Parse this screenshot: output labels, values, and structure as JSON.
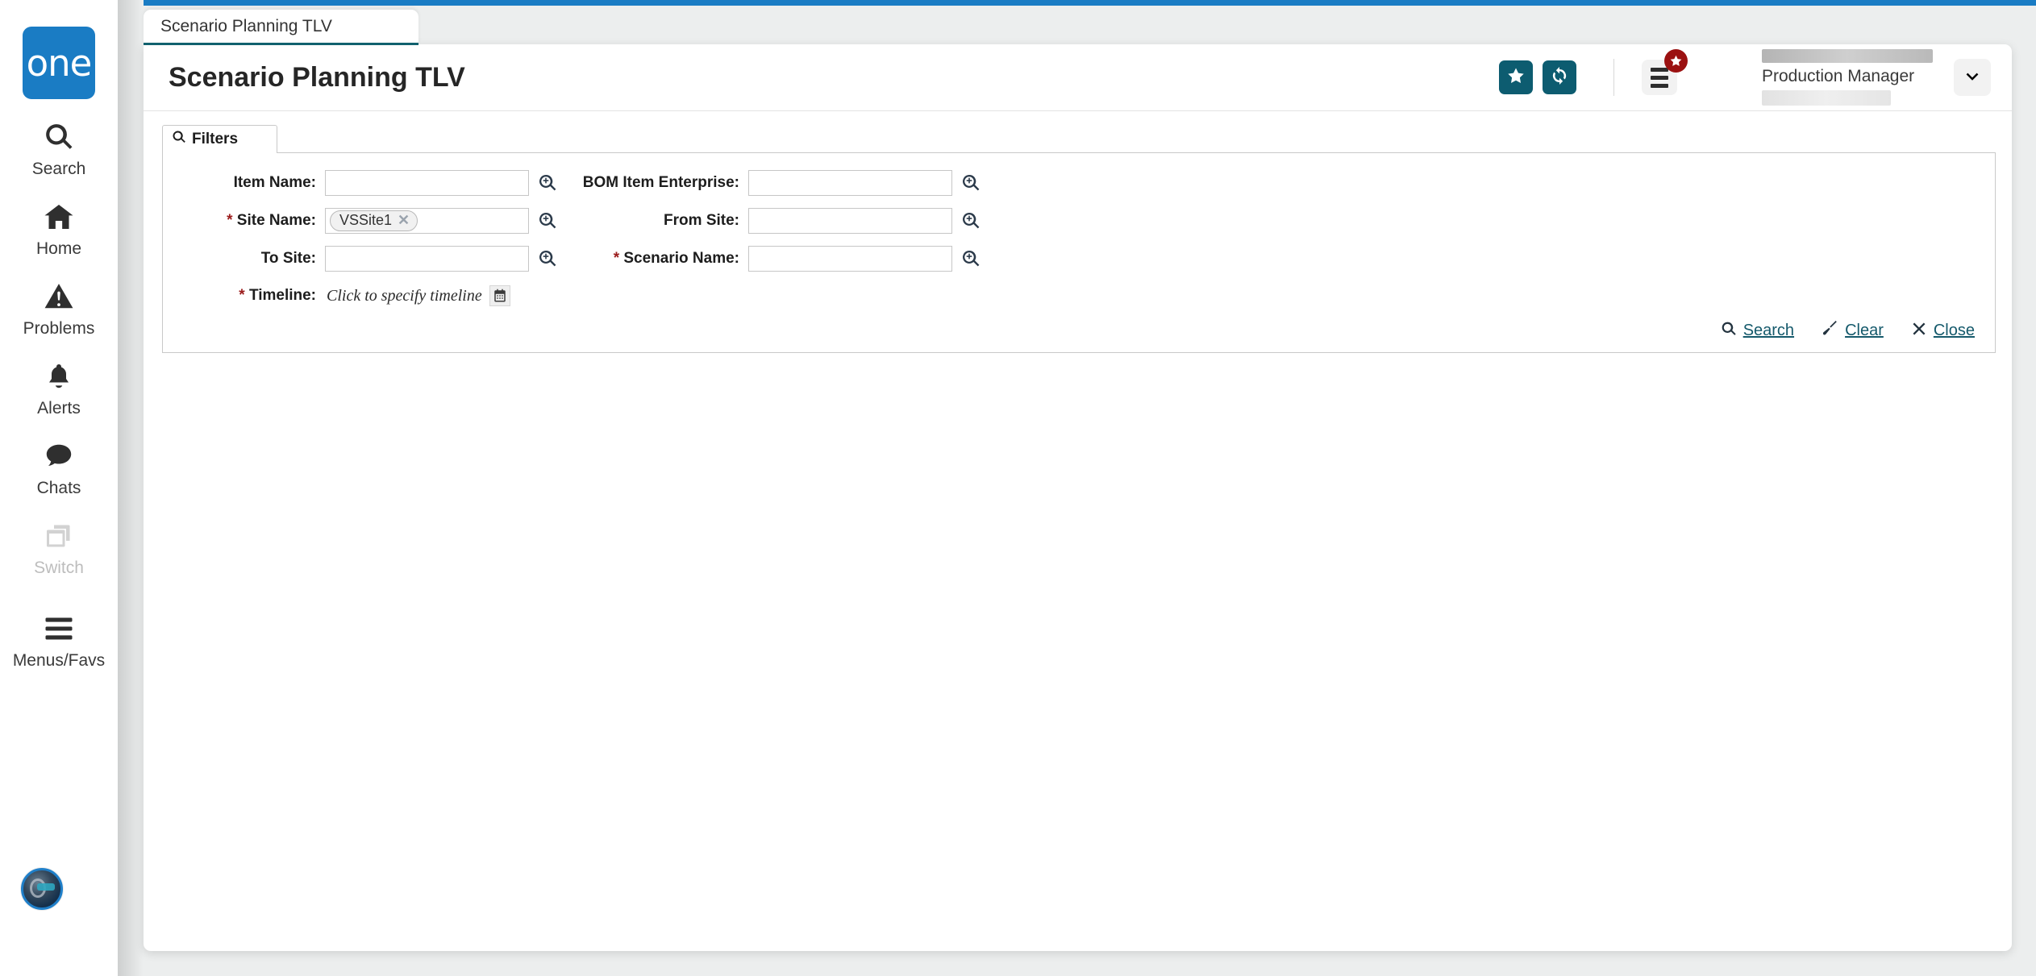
{
  "brand": {
    "logo_text": "one",
    "logo_color": "#1a7cc4"
  },
  "theme": {
    "accent_teal": "#0d5c70",
    "accent_blue": "#1a7cc4",
    "badge_red": "#9b1111",
    "link_teal": "#14596b",
    "required_red": "#9b1c1c"
  },
  "sidebar": {
    "items": [
      {
        "label": "Search",
        "icon": "search-icon",
        "disabled": false
      },
      {
        "label": "Home",
        "icon": "home-icon",
        "disabled": false
      },
      {
        "label": "Problems",
        "icon": "warning-icon",
        "disabled": false
      },
      {
        "label": "Alerts",
        "icon": "bell-icon",
        "disabled": false
      },
      {
        "label": "Chats",
        "icon": "chat-bubble-icon",
        "disabled": false
      },
      {
        "label": "Switch",
        "icon": "switch-icon",
        "disabled": true
      },
      {
        "label": "Menus/Favs",
        "icon": "hamburger-icon",
        "disabled": false
      }
    ],
    "assistant_icon": "ai-assistant-avatar-icon"
  },
  "tabs": [
    {
      "label": "Scenario Planning TLV",
      "active": true
    }
  ],
  "header": {
    "title": "Scenario Planning TLV",
    "favorite_icon": "star-icon",
    "refresh_icon": "refresh-icon",
    "menu_icon": "menu-list-icon",
    "menu_badge_icon": "star-badge-icon",
    "user_role": "Production Manager",
    "user_caret_icon": "chevron-down-icon"
  },
  "filters": {
    "tab_label": "Filters",
    "tab_icon": "search-icon",
    "fields": {
      "item_name": {
        "label": "Item Name:",
        "value": "",
        "required": false,
        "lookup_icon": "zoom-in-icon"
      },
      "site_name": {
        "label": "Site Name:",
        "value": "",
        "required": true,
        "lookup_icon": "zoom-in-icon",
        "chip": "VSSite1",
        "chip_remove_icon": "close-icon"
      },
      "to_site": {
        "label": "To Site:",
        "value": "",
        "required": false,
        "lookup_icon": "zoom-in-icon"
      },
      "timeline": {
        "label": "Timeline:",
        "value": "",
        "required": true,
        "placeholder": "Click to specify timeline",
        "calendar_icon": "calendar-icon"
      },
      "bom_item_enterprise": {
        "label": "BOM Item Enterprise:",
        "value": "",
        "required": false,
        "lookup_icon": "zoom-in-icon"
      },
      "from_site": {
        "label": "From Site:",
        "value": "",
        "required": false,
        "lookup_icon": "zoom-in-icon"
      },
      "scenario_name": {
        "label": "Scenario Name:",
        "value": "",
        "required": true,
        "lookup_icon": "zoom-in-icon"
      }
    },
    "actions": [
      {
        "label": "Search",
        "icon": "search-icon"
      },
      {
        "label": "Clear",
        "icon": "broom-icon"
      },
      {
        "label": "Close",
        "icon": "close-icon"
      }
    ]
  }
}
